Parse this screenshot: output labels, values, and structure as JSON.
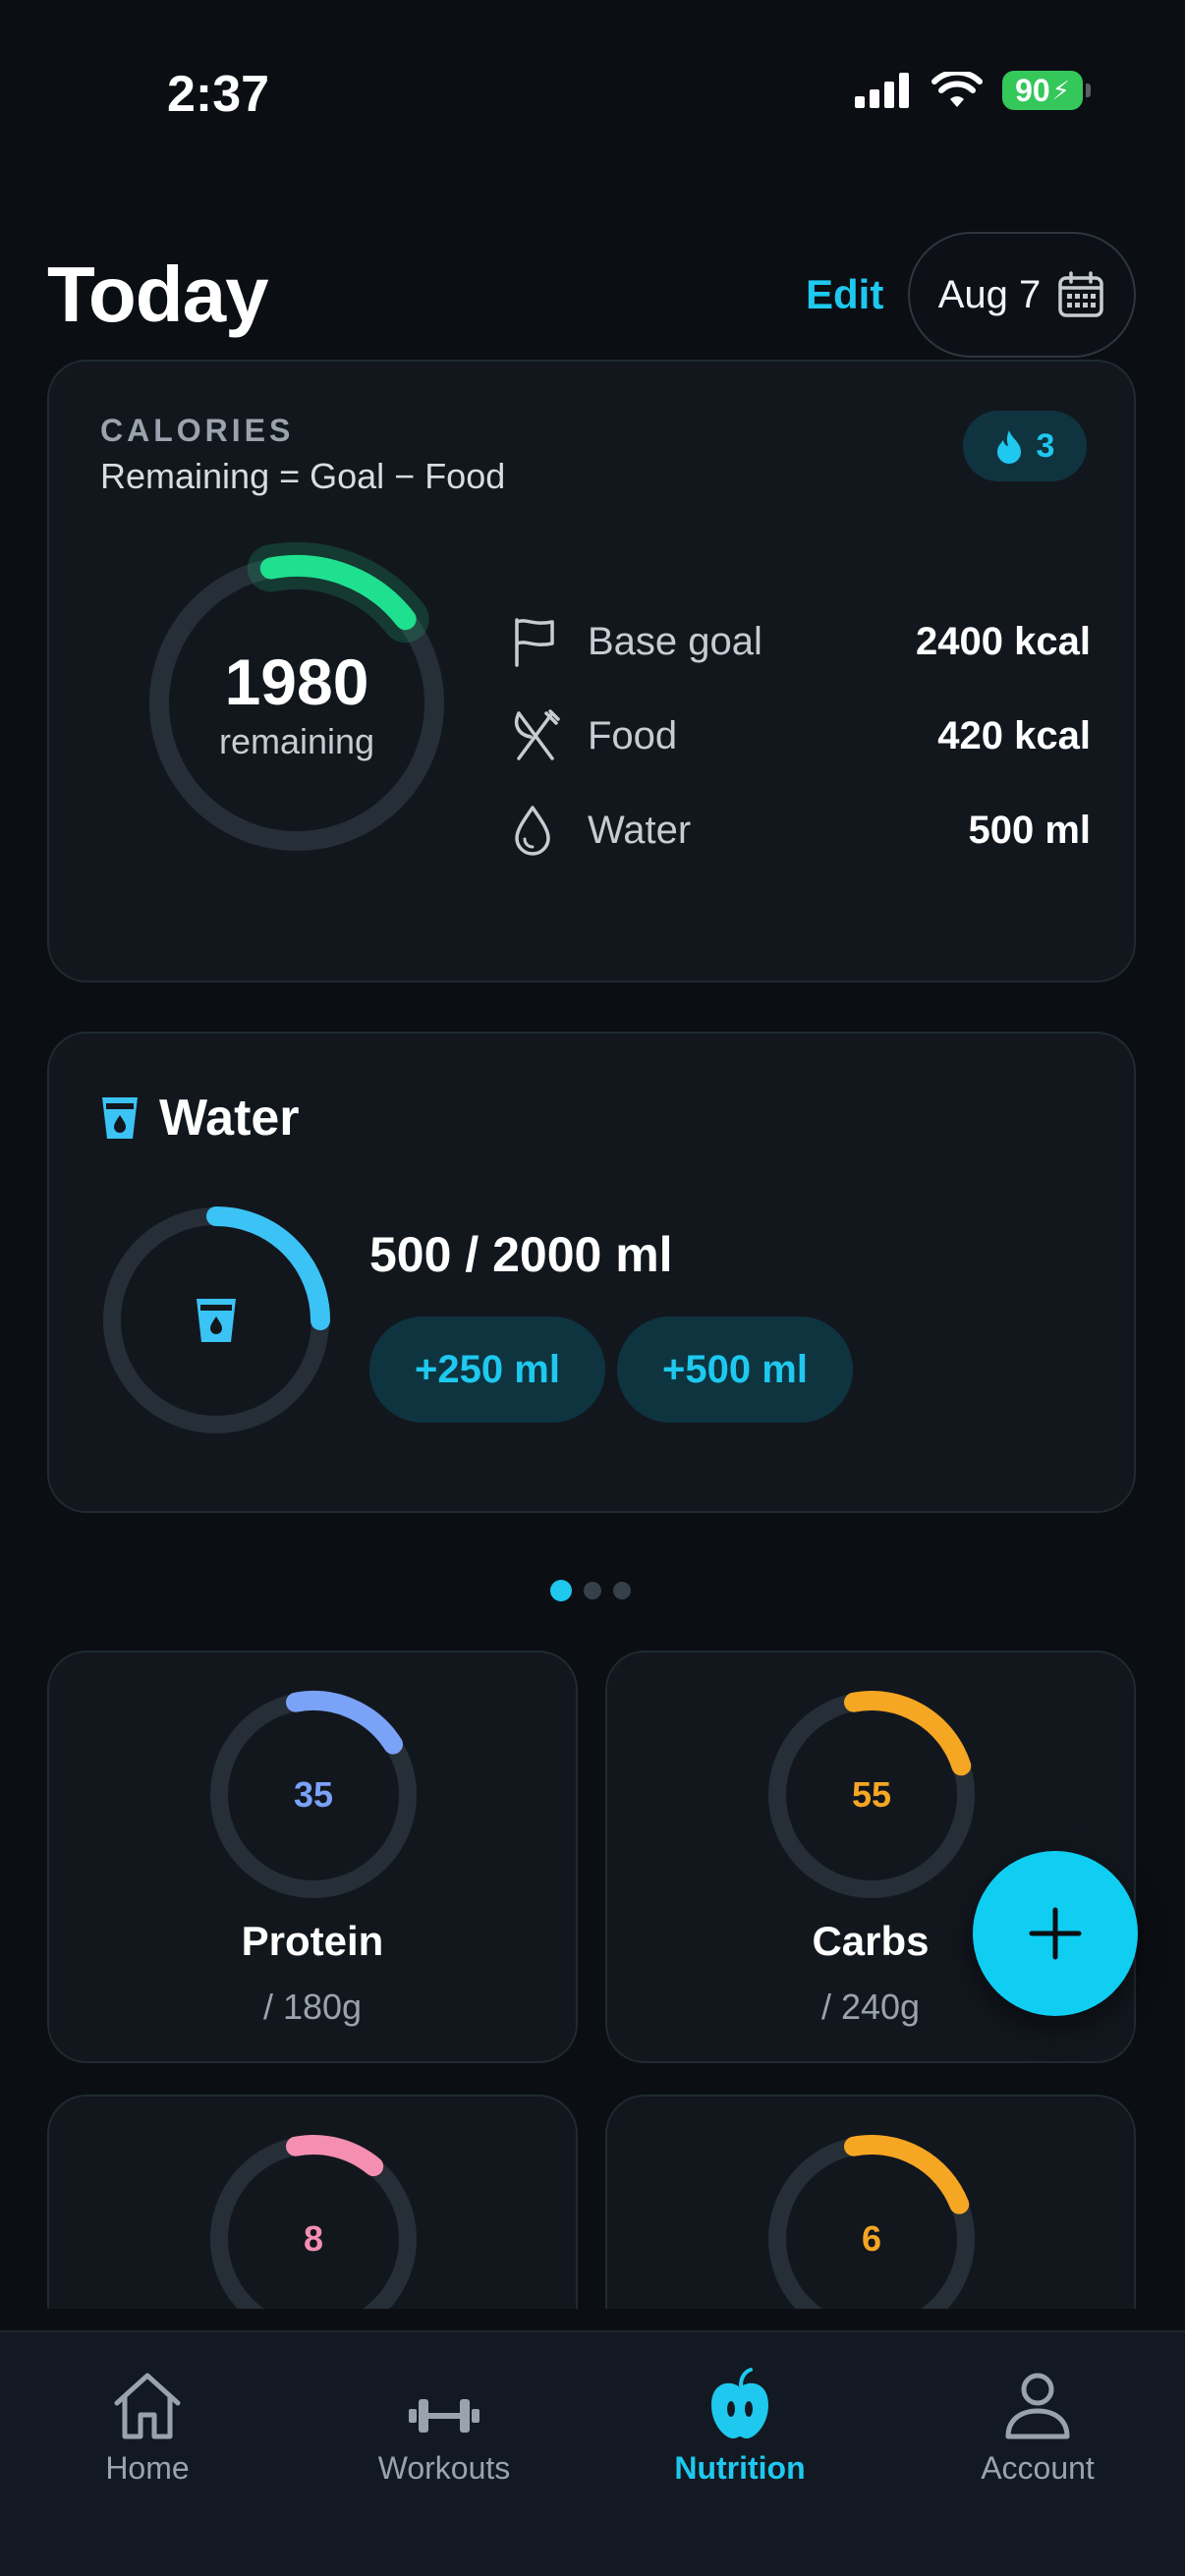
{
  "status_bar": {
    "time": "2:37",
    "battery": "90"
  },
  "header": {
    "title": "Today",
    "edit_label": "Edit",
    "date": "Aug 7"
  },
  "calories": {
    "section_label": "CALORIES",
    "formula": "Remaining = Goal − Food",
    "streak_count": "3",
    "remaining_value": "1980",
    "remaining_label": "remaining",
    "progress_fraction": 0.175,
    "stats": [
      {
        "icon": "flag-icon",
        "label": "Base goal",
        "value": "2400 kcal"
      },
      {
        "icon": "fork-knife-icon",
        "label": "Food",
        "value": "420 kcal"
      },
      {
        "icon": "water-drop-icon",
        "label": "Water",
        "value": "500 ml"
      }
    ]
  },
  "water": {
    "title": "Water",
    "amount": "500 / 2000 ml",
    "progress_fraction": 0.25,
    "quick_add": [
      "+250 ml",
      "+500 ml"
    ]
  },
  "pager": {
    "pages": 3,
    "active_index": 0
  },
  "macros": [
    {
      "name": "Protein",
      "value": "35",
      "goal": "/ 180g",
      "color": "#7aa2f7",
      "fraction": 0.19
    },
    {
      "name": "Carbs",
      "value": "55",
      "goal": "/ 240g",
      "color": "#f5a623",
      "fraction": 0.23
    },
    {
      "name": "",
      "value": "8",
      "goal": "",
      "color": "#f48fb1",
      "fraction": 0.14
    },
    {
      "name": "",
      "value": "6",
      "goal": "",
      "color": "#f5a623",
      "fraction": 0.22
    }
  ],
  "tabs": [
    {
      "label": "Home",
      "icon": "home-icon",
      "active": false
    },
    {
      "label": "Workouts",
      "icon": "dumbbell-icon",
      "active": false
    },
    {
      "label": "Nutrition",
      "icon": "apple-icon",
      "active": true
    },
    {
      "label": "Account",
      "icon": "person-icon",
      "active": false
    }
  ],
  "colors": {
    "accent": "#1ec8ee",
    "calorie_ring": "#1fe08f",
    "water_ring": "#3cc3f5",
    "background": "#0b0e13",
    "card": "#12171e"
  }
}
